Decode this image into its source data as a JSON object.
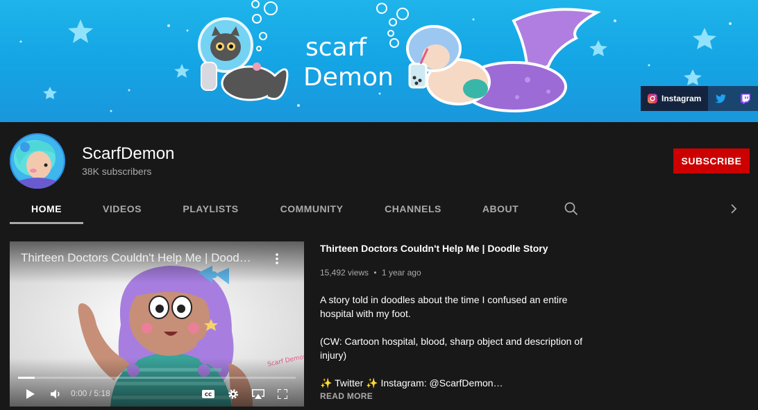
{
  "banner": {
    "art_text_line1": "scarf",
    "art_text_line2": "Demon",
    "links": [
      {
        "label": "Instagram",
        "icon": "instagram-icon"
      },
      {
        "label": "",
        "icon": "twitter-icon"
      },
      {
        "label": "",
        "icon": "twitch-icon"
      }
    ]
  },
  "channel": {
    "name": "ScarfDemon",
    "subscribers": "38K subscribers",
    "subscribe_label": "SUBSCRIBE"
  },
  "tabs": [
    "HOME",
    "VIDEOS",
    "PLAYLISTS",
    "COMMUNITY",
    "CHANNELS",
    "ABOUT"
  ],
  "active_tab": "HOME",
  "video": {
    "player_title": "Thirteen Doctors Couldn't Help Me | Dood…",
    "title": "Thirteen Doctors Couldn't Help Me | Doodle Story",
    "views": "15,492 views",
    "age": "1 year ago",
    "meta_separator": "•",
    "time_display": "0:00 / 5:18",
    "progress_fraction": 0.06,
    "cc_label": "CC",
    "watermark": "Scarf Demon",
    "description": "A story told in doodles about the time I confused an entire hospital with my foot.\n\n(CW: Cartoon hospital, blood, sharp object and description of injury)\n\n✨ Twitter ✨ Instagram: @ScarfDemon…",
    "read_more": "READ MORE"
  },
  "colors": {
    "banner_bg": "#17a8e6",
    "subscribe_red": "#cc0000",
    "page_bg": "#181818",
    "secondary_text": "#aaaaaa"
  }
}
